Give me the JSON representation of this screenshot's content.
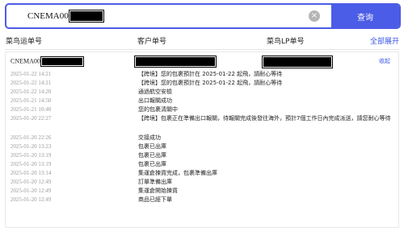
{
  "search": {
    "query": "CNEMA00",
    "button_label": "查询",
    "clear_icon": "×"
  },
  "header": {
    "col1": "菜鸟运单号",
    "col2": "客户单号",
    "col3": "菜鸟LP单号",
    "expand_all": "全部展开"
  },
  "shipment": {
    "order_no_prefix": "CNEMA00",
    "collapse_label": "收起",
    "events": [
      {
        "time": "2025-01-22 14:21",
        "desc": "【跨境】您的包裹預計在 2025-01-22 起飛，請耐心等待"
      },
      {
        "time": "2025-01-22 14:21",
        "desc": "【跨境】您的包裹預計在 2025-01-22 起飛，請耐心等待"
      },
      {
        "time": "2025-01-22 14:20",
        "desc": "通過航空安檢"
      },
      {
        "time": "2025-01-21 14:50",
        "desc": "出口報關成功"
      },
      {
        "time": "2025-01-21 10:40",
        "desc": "您的包裹清關中"
      },
      {
        "time": "2025-01-20 22:27",
        "desc": "【跨境】包裹正在準備出口報關，待報關完成後發往海外，預計7個工作日內完成派送，請您耐心等待"
      },
      {
        "time": "2025-01-20 22:26",
        "desc": "交接成功"
      },
      {
        "time": "2025-01-20 13:23",
        "desc": "包裹已出庫"
      },
      {
        "time": "2025-01-20 13:19",
        "desc": "包裹已出庫"
      },
      {
        "time": "2025-01-20 13:19",
        "desc": "包裹已出庫"
      },
      {
        "time": "2025-01-20 13:14",
        "desc": "集運倉揀貨完成，包裹準備出庫"
      },
      {
        "time": "2025-01-20 12:49",
        "desc": "訂單準備出庫"
      },
      {
        "time": "2025-01-20 12:49",
        "desc": "集運倉開始揀貨"
      },
      {
        "time": "2025-01-20 12:49",
        "desc": "商品已經下單"
      }
    ]
  }
}
